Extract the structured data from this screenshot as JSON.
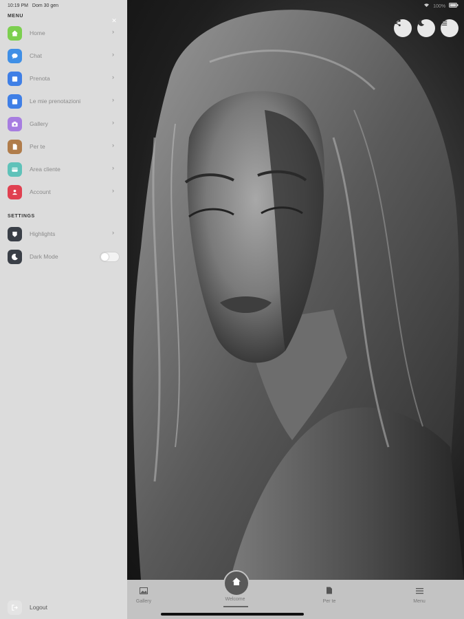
{
  "status_bar": {
    "time": "10:19 PM",
    "date": "Dom 30 gen",
    "battery": "100%"
  },
  "sidebar": {
    "menu_title": "MENU",
    "settings_title": "SETTINGS",
    "close_icon": "close-icon",
    "items": [
      {
        "label": "Home",
        "icon": "home-icon",
        "color": "#7ccf4f"
      },
      {
        "label": "Chat",
        "icon": "chat-icon",
        "color": "#3f8fe6"
      },
      {
        "label": "Prenota",
        "icon": "calendar-icon",
        "color": "#3f7fe6"
      },
      {
        "label": "Le mie prenotazioni",
        "icon": "calendar-check-icon",
        "color": "#3f7fe6"
      },
      {
        "label": "Gallery",
        "icon": "camera-icon",
        "color": "#a77de0"
      },
      {
        "label": "Per te",
        "icon": "document-icon",
        "color": "#b07c4a"
      },
      {
        "label": "Area cliente",
        "icon": "card-icon",
        "color": "#5fc2b9"
      },
      {
        "label": "Account",
        "icon": "user-icon",
        "color": "#e04050"
      }
    ],
    "settings": [
      {
        "label": "Highlights",
        "icon": "highlight-icon",
        "color": "#3a3f47"
      },
      {
        "label": "Dark Mode",
        "icon": "moon-icon",
        "color": "#3a3f47",
        "toggle": false
      }
    ],
    "logout_label": "Logout"
  },
  "top_buttons": [
    {
      "icon": "share-icon"
    },
    {
      "icon": "moon-icon"
    },
    {
      "icon": "menu-icon"
    }
  ],
  "tabbar": {
    "tabs": [
      {
        "label": "Gallery",
        "icon": "image-icon"
      },
      {
        "label": "Welcome",
        "icon": "home-icon",
        "active": true
      },
      {
        "label": "Per te",
        "icon": "document-icon"
      },
      {
        "label": "Menu",
        "icon": "menu-icon"
      }
    ]
  }
}
